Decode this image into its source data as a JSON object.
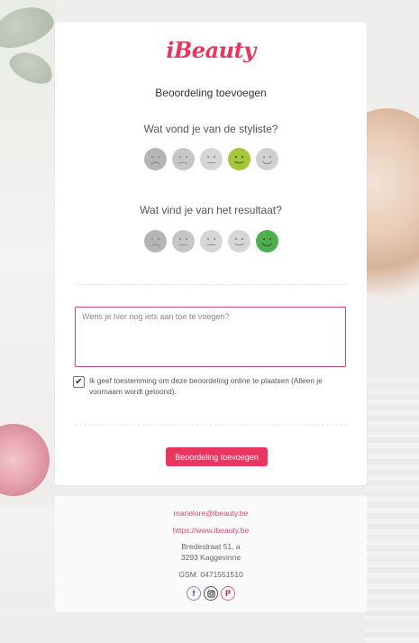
{
  "brand": {
    "logo_text": "iBeauty",
    "accent_color": "#e8365f"
  },
  "form": {
    "title": "Beoordeling toevoegen",
    "question_stylist": "Wat vond je van de styliste?",
    "question_result": "Wat vind je van het resultaat?",
    "stylist_rating": {
      "selected": 4,
      "max": 5,
      "selected_color": "#a4c639"
    },
    "result_rating": {
      "selected": 5,
      "max": 5,
      "selected_color": "#4caf50"
    },
    "comment_placeholder": "Wens je hier nog iets aan toe te voegen?",
    "consent_checked": true,
    "consent_label": "Ik geef toestemming om deze beoordeling online te plaatsen (Alleen je voornaam wordt getoond).",
    "submit_label": "Beoordeling toevoegen"
  },
  "footer": {
    "email": "marielore@ibeauty.be",
    "website": "https://www.ibeauty.be",
    "address_line1": "Bredestraat 51, a",
    "address_line2": "3293 Kaggevinne",
    "phone": "GSM: 0471551510",
    "socials": [
      "facebook-icon",
      "instagram-icon",
      "pinterest-icon"
    ]
  }
}
